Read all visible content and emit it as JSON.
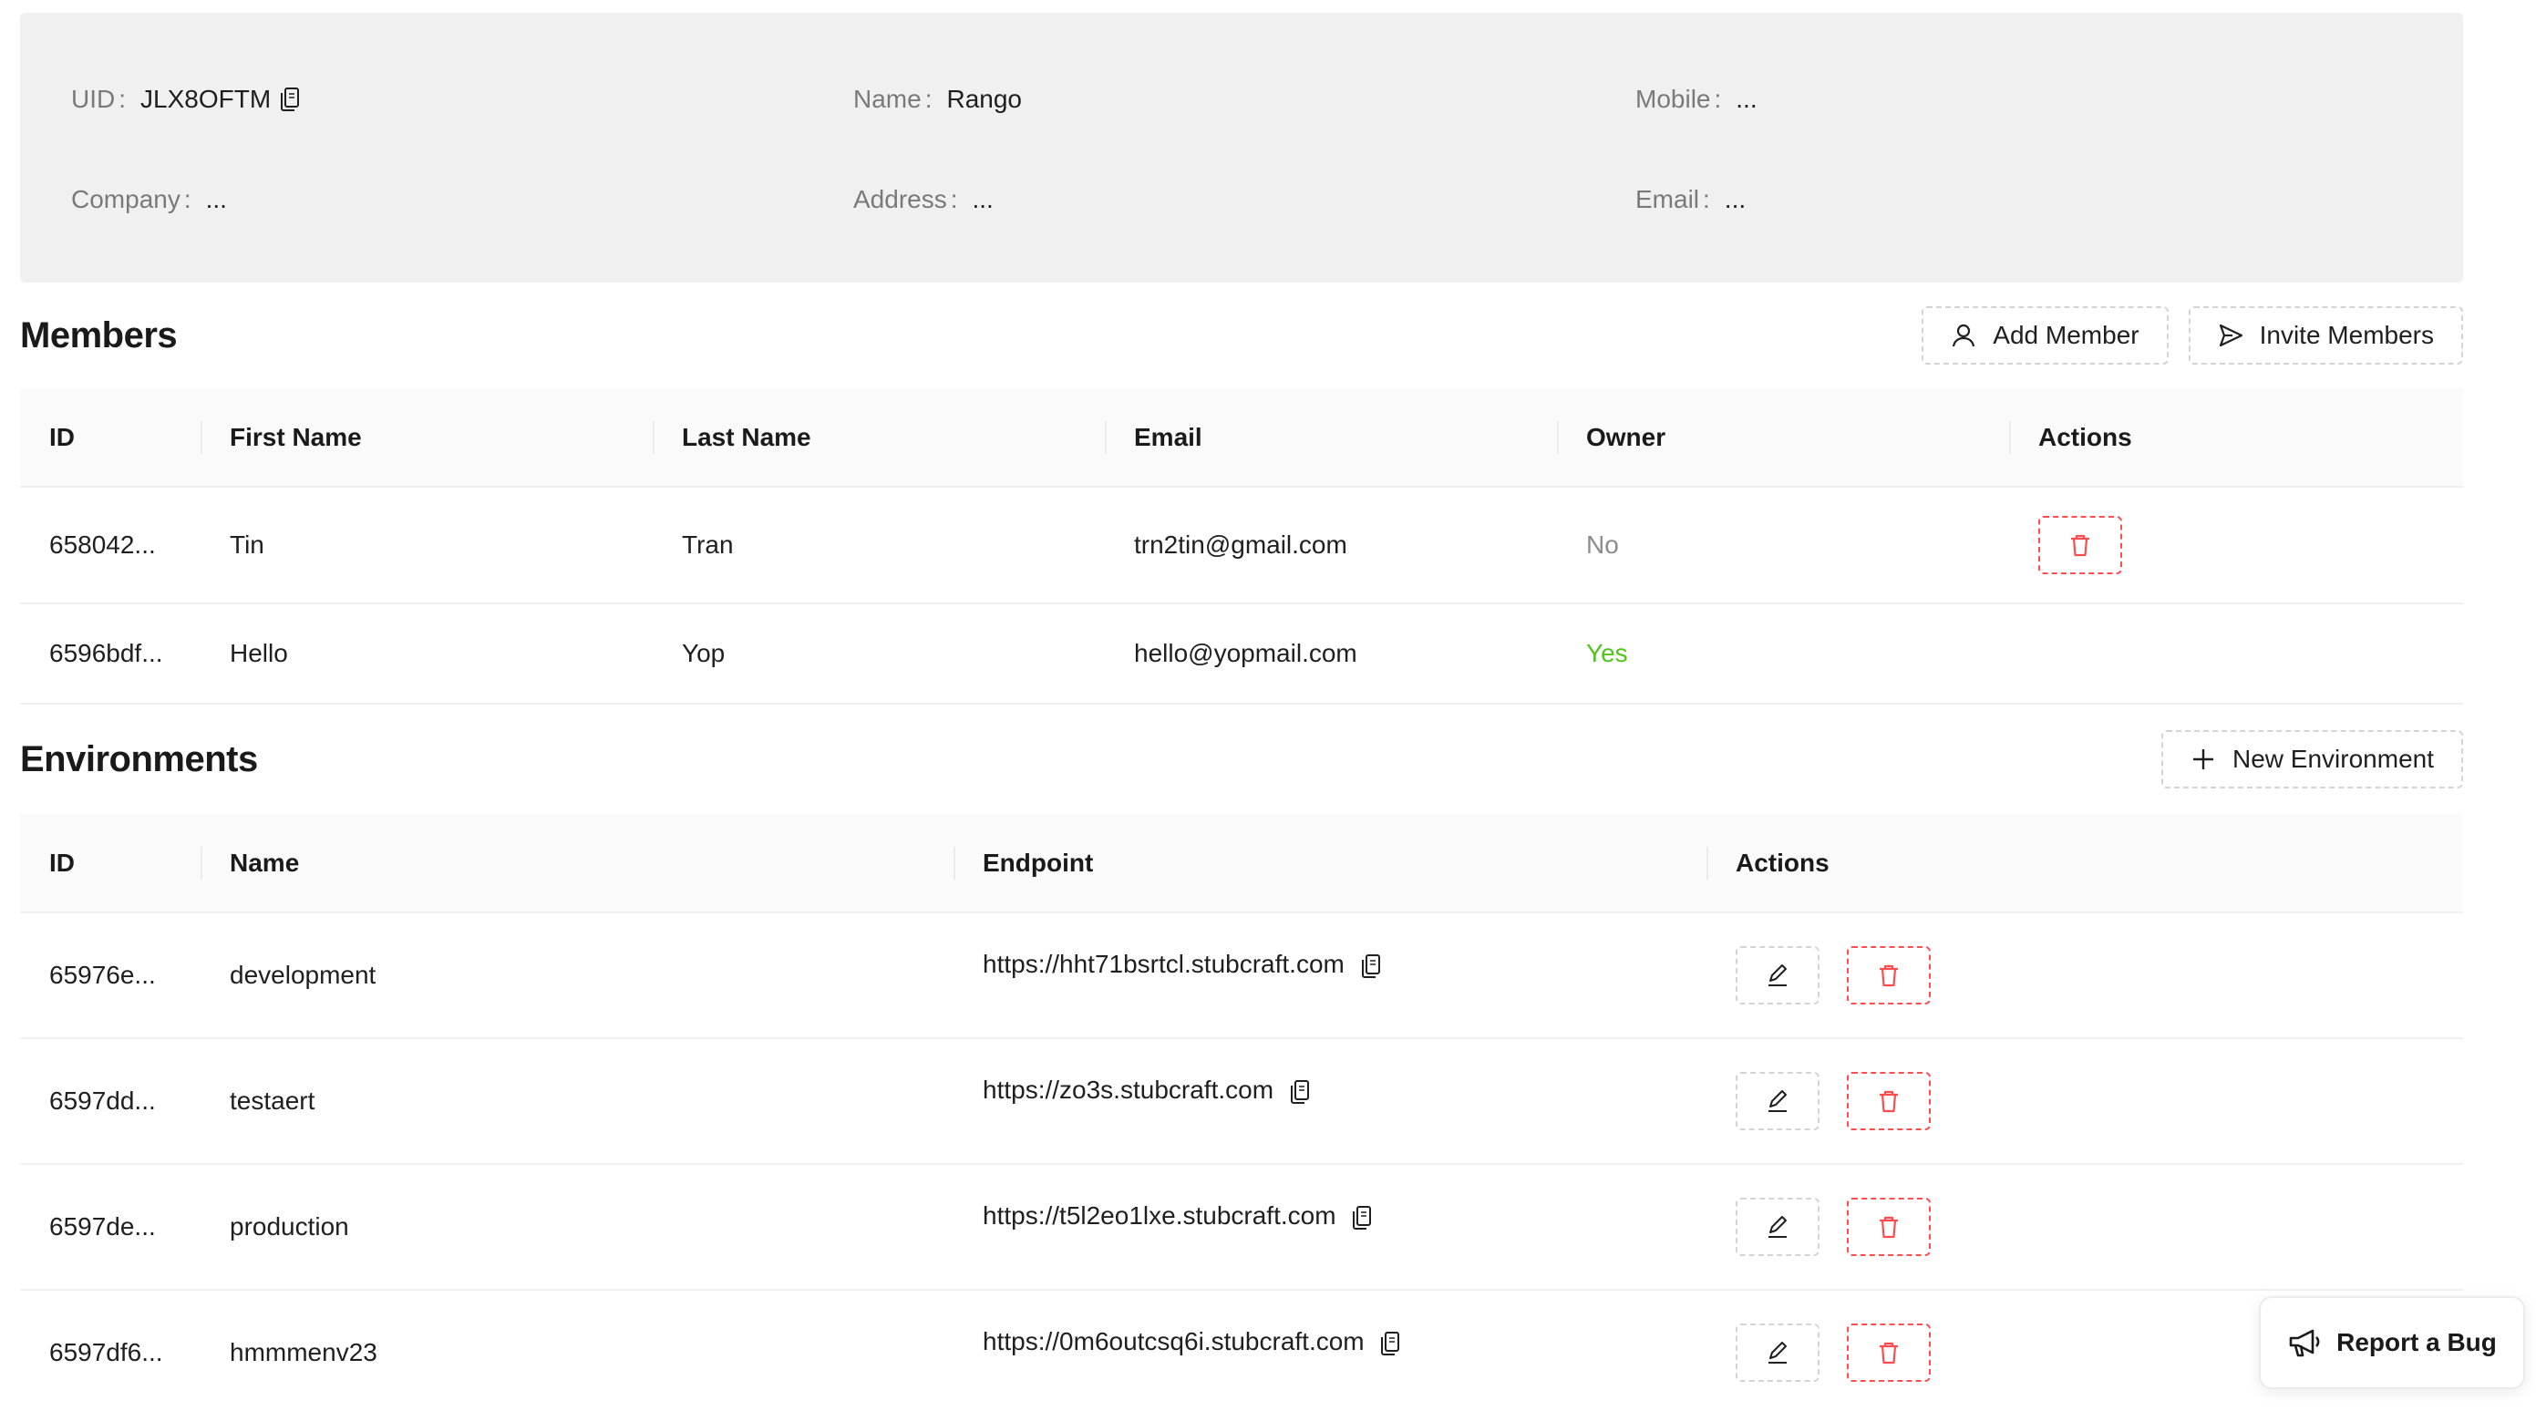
{
  "company_info": {
    "uid_label": "UID",
    "uid_value": "JLX8OFTM",
    "name_label": "Name",
    "name_value": "Rango",
    "mobile_label": "Mobile",
    "mobile_value": "...",
    "company_label": "Company",
    "company_value": "...",
    "address_label": "Address",
    "address_value": "...",
    "email_label": "Email",
    "email_value": "...",
    "colon": ":"
  },
  "members": {
    "title": "Members",
    "add_member_label": "Add Member",
    "invite_members_label": "Invite Members",
    "columns": [
      "ID",
      "First Name",
      "Last Name",
      "Email",
      "Owner",
      "Actions"
    ],
    "rows": [
      {
        "id": "658042...",
        "first_name": "Tin",
        "last_name": "Tran",
        "email": "trn2tin@gmail.com",
        "owner": "No"
      },
      {
        "id": "6596bdf...",
        "first_name": "Hello",
        "last_name": "Yop",
        "email": "hello@yopmail.com",
        "owner": "Yes"
      }
    ]
  },
  "environments": {
    "title": "Environments",
    "new_environment_label": "New Environment",
    "columns": [
      "ID",
      "Name",
      "Endpoint",
      "Actions"
    ],
    "rows": [
      {
        "id": "65976e...",
        "name": "development",
        "endpoint": "https://hht71bsrtcl.stubcraft.com"
      },
      {
        "id": "6597dd...",
        "name": "testaert",
        "endpoint": "https://zo3s.stubcraft.com"
      },
      {
        "id": "6597de...",
        "name": "production",
        "endpoint": "https://t5l2eo1lxe.stubcraft.com"
      },
      {
        "id": "6597df6...",
        "name": "hmmmenv23",
        "endpoint": "https://0m6outcsq6i.stubcraft.com"
      }
    ]
  },
  "report_bug": {
    "label": "Report a Bug"
  },
  "colors": {
    "panel_bg": "#f0f0f0",
    "danger": "#ff4d4f",
    "success": "#52c41a",
    "muted": "#8c8c8c"
  },
  "icons": {
    "copy": "copy-icon",
    "user": "user-icon",
    "send": "send-icon",
    "plus": "plus-icon",
    "edit": "edit-icon",
    "delete": "trash-icon",
    "megaphone": "megaphone-icon"
  }
}
